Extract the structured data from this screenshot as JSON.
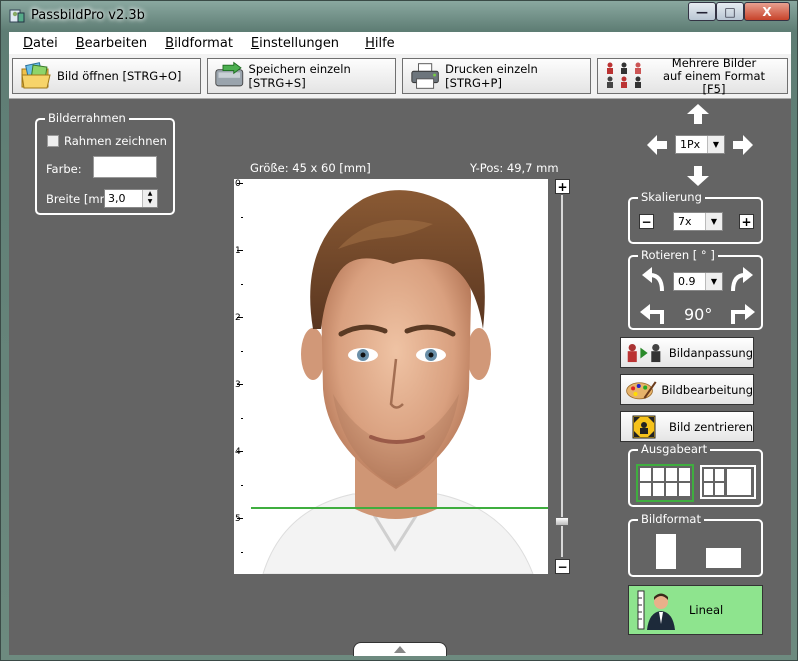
{
  "window": {
    "title": "PassbildPro  v2.3b",
    "controls": {
      "minimize": "—",
      "maximize": "□",
      "close": "X"
    }
  },
  "menu": [
    "Datei",
    "Bearbeiten",
    "Bildformat",
    "Einstellungen",
    "Hilfe"
  ],
  "toolbar": {
    "open": "Bild öffnen [STRG+O]",
    "save": "Speichern einzeln [STRG+S]",
    "print": "Drucken einzeln [STRG+P]",
    "multi_line1": "Mehrere Bilder",
    "multi_line2": "auf einem Format [F5]"
  },
  "bilderrahmen": {
    "legend": "Bilderrahmen",
    "checkbox_label": "Rahmen zeichnen",
    "checked": false,
    "color_label": "Farbe:",
    "width_label": "Breite [mm]:",
    "width_value": "3,0"
  },
  "photo": {
    "size_label": "Größe: 45 x 60 [mm]",
    "ypos_label": "Y-Pos: 49,7 mm",
    "ruler_numbers": [
      "0",
      "1",
      "2",
      "3",
      "4",
      "5"
    ],
    "slider_plus": "+",
    "slider_minus": "−"
  },
  "move": {
    "step": "1Px"
  },
  "skalierung": {
    "legend": "Skalierung",
    "value": "7x",
    "minus": "−",
    "plus": "+"
  },
  "rotieren": {
    "legend": "Rotieren [ ° ]",
    "value": "0.9",
    "label_90": "90°"
  },
  "actions": {
    "bildanpassung": "Bildanpassung",
    "bildbearbeitung": "Bildbearbeitung",
    "zentrieren": "Bild zentrieren"
  },
  "ausgabeart": {
    "legend": "Ausgabeart"
  },
  "bildformat": {
    "legend": "Bildformat"
  },
  "lineal": {
    "label": "Lineal"
  },
  "colors": {
    "accent_green": "#3fae3f",
    "lineal_bg": "#8ee48e",
    "content_bg": "#646464"
  }
}
